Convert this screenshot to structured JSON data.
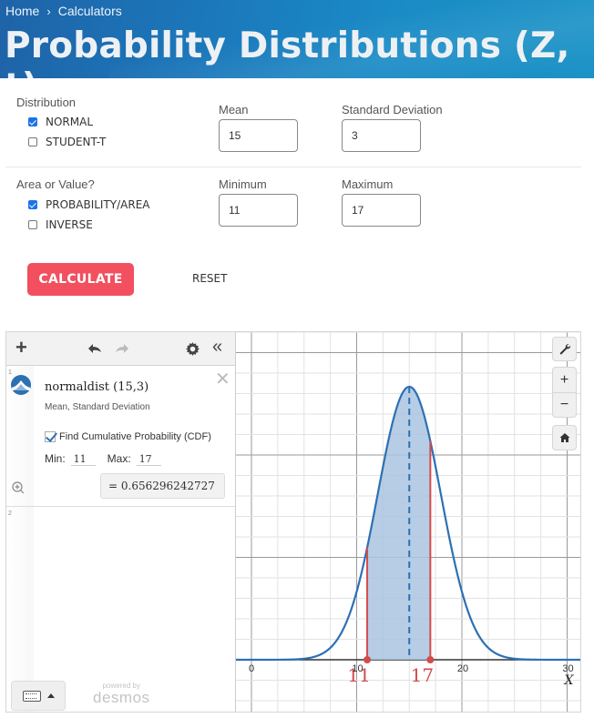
{
  "header": {
    "breadcrumb": [
      {
        "label": "Home"
      },
      {
        "label": "Calculators"
      }
    ],
    "breadcrumb_separator": "›",
    "title": "Probability Distributions (Z, t)"
  },
  "form": {
    "distribution": {
      "label": "Distribution",
      "options": [
        {
          "label": "NORMAL",
          "checked": true
        },
        {
          "label": "STUDENT-T",
          "checked": false
        }
      ]
    },
    "mean": {
      "label": "Mean",
      "value": "15"
    },
    "std_dev": {
      "label": "Standard Deviation",
      "value": "3"
    },
    "area_or_value": {
      "label": "Area or Value?",
      "options": [
        {
          "label": "PROBABILITY/AREA",
          "checked": true
        },
        {
          "label": "INVERSE",
          "checked": false
        }
      ]
    },
    "minimum": {
      "label": "Minimum",
      "value": "11"
    },
    "maximum": {
      "label": "Maximum",
      "value": "17"
    },
    "calculate_label": "CALCULATE",
    "reset_label": "RESET",
    "accent_color": "#f24f5f"
  },
  "desmos": {
    "toolbar": {
      "add_icon": "plus-icon",
      "undo_icon": "undo-icon",
      "redo_icon": "redo-icon",
      "settings_icon": "gear-icon",
      "collapse_icon": "double-chevron-left-icon"
    },
    "expressions": [
      {
        "number": "1",
        "title": "normaldist (15,3)",
        "subtitle": "Mean,  Standard Deviation",
        "cdf_label": "Find Cumulative Probability (CDF)",
        "cdf_checked": true,
        "min_label": "Min:",
        "min_value": "11",
        "max_label": "Max:",
        "max_value": "17",
        "result": "=  0.656296242727"
      },
      {
        "number": "2"
      }
    ],
    "powered_by": "powered by",
    "brand": "desmos",
    "graph_controls": [
      "wrench-icon",
      "zoom-in-icon",
      "zoom-out-icon",
      "home-icon"
    ],
    "zoom_in_label": "+",
    "zoom_out_label": "−"
  },
  "chart_data": {
    "type": "line",
    "title": "normaldist(15,3)",
    "distribution": {
      "mean": 15,
      "sd": 3
    },
    "shaded_interval": [
      11,
      17
    ],
    "shaded_probability": 0.656296242727,
    "xlabel": "X",
    "ylabel": "",
    "x_ticks": [
      "0",
      "10",
      "20",
      "30"
    ],
    "x_range": [
      -1.5,
      31.5
    ],
    "bound_labels": [
      "11",
      "17"
    ],
    "grid": true,
    "curve_color": "#2d70b3",
    "fill_color": "#a9c4e0",
    "bound_color": "#d34b4b"
  }
}
